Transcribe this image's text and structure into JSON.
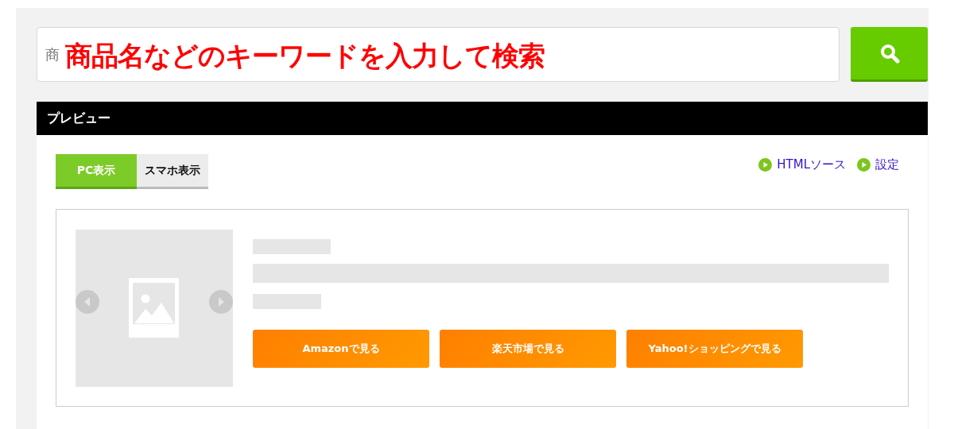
{
  "search": {
    "placeholder": "商",
    "annotation": "商品名などのキーワードを入力して検索"
  },
  "preview": {
    "title": "プレビュー",
    "tabs": [
      {
        "label": "PC表示",
        "selected": true
      },
      {
        "label": "スマホ表示",
        "selected": false
      }
    ],
    "links": [
      "HTMLソース",
      "設定"
    ],
    "card": {
      "buttons": [
        "Amazonで見る",
        "楽天市場で見る",
        "Yahoo!ショッピングで見る"
      ]
    }
  }
}
